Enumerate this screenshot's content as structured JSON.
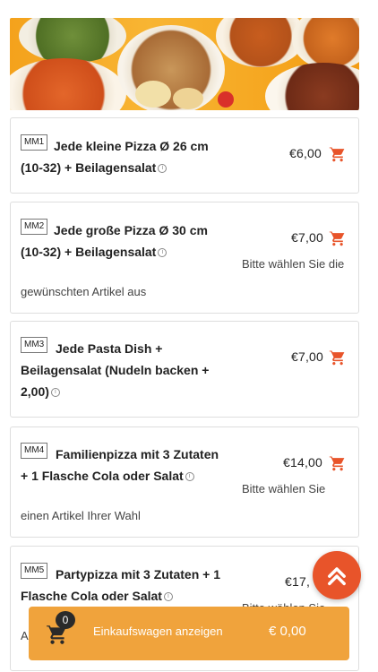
{
  "colors": {
    "accent": "#e8542a",
    "cart_bar": "#f0a33c",
    "border": "#dedede"
  },
  "banner": {
    "icon": "food-dishes-banner"
  },
  "items": [
    {
      "code": "MM1",
      "title_line1": "Jede kleine Pizza Ø 26 cm",
      "title_line2": "(10-32) + Beilagensalat",
      "title_line3": "",
      "price": "€6,00",
      "note_line1": "",
      "note_line2": ""
    },
    {
      "code": "MM2",
      "title_line1": "Jede große Pizza Ø 30 cm",
      "title_line2": "(10-32) + Beilagensalat",
      "title_line3": "",
      "price": "€7,00",
      "note_line1": "Bitte wählen Sie die",
      "note_line2": "gewünschten Artikel aus"
    },
    {
      "code": "MM3",
      "title_line1": "Jede Pasta Dish +",
      "title_line2": "Beilagensalat (Nudeln backen +",
      "title_line3": "2,00)",
      "price": "€7,00",
      "note_line1": "",
      "note_line2": ""
    },
    {
      "code": "MM4",
      "title_line1": "Familienpizza mit 3 Zutaten",
      "title_line2": "+ 1 Flasche Cola oder Salat",
      "title_line3": "",
      "price": "€14,00",
      "note_line1": "Bitte wählen Sie",
      "note_line2": "einen Artikel Ihrer Wahl"
    },
    {
      "code": "MM5",
      "title_line1": "Partypizza mit 3 Zutaten + 1",
      "title_line2": "Flasche Cola oder Salat",
      "title_line3": "",
      "price": "€17,",
      "note_line1": "Bitte wählen Sie",
      "note_line2": "A"
    }
  ],
  "cart_bar": {
    "count": "0",
    "label": "Einkaufswagen anzeigen",
    "total": "€ 0,00"
  }
}
